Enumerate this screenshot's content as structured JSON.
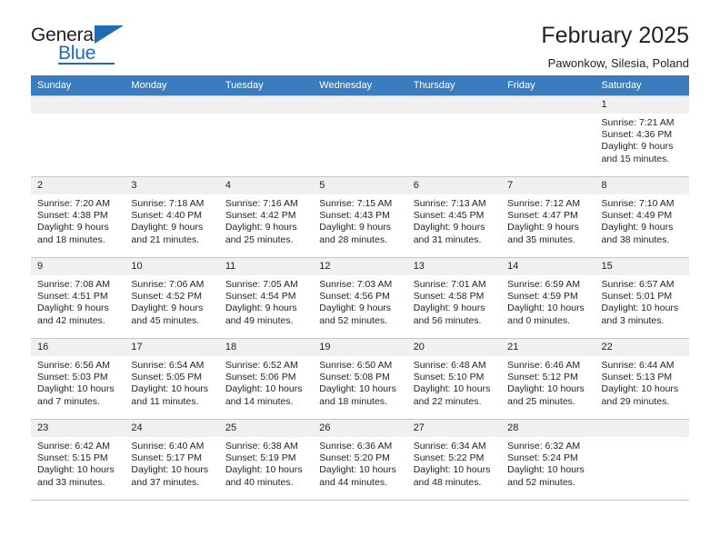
{
  "logo": {
    "word_one": "General",
    "word_two": "Blue",
    "triangle_icon": "triangle-icon"
  },
  "header": {
    "title": "February 2025",
    "location": "Pawonkow, Silesia, Poland"
  },
  "colors": {
    "header_blue": "#3a7cbe",
    "logo_blue": "#1f6cb4",
    "daynum_bg": "#f0f0f0",
    "grid_line": "#c8c8c8",
    "text": "#231f20"
  },
  "weekday_headers": [
    "Sunday",
    "Monday",
    "Tuesday",
    "Wednesday",
    "Thursday",
    "Friday",
    "Saturday"
  ],
  "weeks": [
    [
      {
        "day": "",
        "empty": true
      },
      {
        "day": "",
        "empty": true
      },
      {
        "day": "",
        "empty": true
      },
      {
        "day": "",
        "empty": true
      },
      {
        "day": "",
        "empty": true
      },
      {
        "day": "",
        "empty": true
      },
      {
        "day": "1",
        "sunrise": "Sunrise: 7:21 AM",
        "sunset": "Sunset: 4:36 PM",
        "daylight_line1": "Daylight: 9 hours",
        "daylight_line2": "and 15 minutes."
      }
    ],
    [
      {
        "day": "2",
        "sunrise": "Sunrise: 7:20 AM",
        "sunset": "Sunset: 4:38 PM",
        "daylight_line1": "Daylight: 9 hours",
        "daylight_line2": "and 18 minutes."
      },
      {
        "day": "3",
        "sunrise": "Sunrise: 7:18 AM",
        "sunset": "Sunset: 4:40 PM",
        "daylight_line1": "Daylight: 9 hours",
        "daylight_line2": "and 21 minutes."
      },
      {
        "day": "4",
        "sunrise": "Sunrise: 7:16 AM",
        "sunset": "Sunset: 4:42 PM",
        "daylight_line1": "Daylight: 9 hours",
        "daylight_line2": "and 25 minutes."
      },
      {
        "day": "5",
        "sunrise": "Sunrise: 7:15 AM",
        "sunset": "Sunset: 4:43 PM",
        "daylight_line1": "Daylight: 9 hours",
        "daylight_line2": "and 28 minutes."
      },
      {
        "day": "6",
        "sunrise": "Sunrise: 7:13 AM",
        "sunset": "Sunset: 4:45 PM",
        "daylight_line1": "Daylight: 9 hours",
        "daylight_line2": "and 31 minutes."
      },
      {
        "day": "7",
        "sunrise": "Sunrise: 7:12 AM",
        "sunset": "Sunset: 4:47 PM",
        "daylight_line1": "Daylight: 9 hours",
        "daylight_line2": "and 35 minutes."
      },
      {
        "day": "8",
        "sunrise": "Sunrise: 7:10 AM",
        "sunset": "Sunset: 4:49 PM",
        "daylight_line1": "Daylight: 9 hours",
        "daylight_line2": "and 38 minutes."
      }
    ],
    [
      {
        "day": "9",
        "sunrise": "Sunrise: 7:08 AM",
        "sunset": "Sunset: 4:51 PM",
        "daylight_line1": "Daylight: 9 hours",
        "daylight_line2": "and 42 minutes."
      },
      {
        "day": "10",
        "sunrise": "Sunrise: 7:06 AM",
        "sunset": "Sunset: 4:52 PM",
        "daylight_line1": "Daylight: 9 hours",
        "daylight_line2": "and 45 minutes."
      },
      {
        "day": "11",
        "sunrise": "Sunrise: 7:05 AM",
        "sunset": "Sunset: 4:54 PM",
        "daylight_line1": "Daylight: 9 hours",
        "daylight_line2": "and 49 minutes."
      },
      {
        "day": "12",
        "sunrise": "Sunrise: 7:03 AM",
        "sunset": "Sunset: 4:56 PM",
        "daylight_line1": "Daylight: 9 hours",
        "daylight_line2": "and 52 minutes."
      },
      {
        "day": "13",
        "sunrise": "Sunrise: 7:01 AM",
        "sunset": "Sunset: 4:58 PM",
        "daylight_line1": "Daylight: 9 hours",
        "daylight_line2": "and 56 minutes."
      },
      {
        "day": "14",
        "sunrise": "Sunrise: 6:59 AM",
        "sunset": "Sunset: 4:59 PM",
        "daylight_line1": "Daylight: 10 hours",
        "daylight_line2": "and 0 minutes."
      },
      {
        "day": "15",
        "sunrise": "Sunrise: 6:57 AM",
        "sunset": "Sunset: 5:01 PM",
        "daylight_line1": "Daylight: 10 hours",
        "daylight_line2": "and 3 minutes."
      }
    ],
    [
      {
        "day": "16",
        "sunrise": "Sunrise: 6:56 AM",
        "sunset": "Sunset: 5:03 PM",
        "daylight_line1": "Daylight: 10 hours",
        "daylight_line2": "and 7 minutes."
      },
      {
        "day": "17",
        "sunrise": "Sunrise: 6:54 AM",
        "sunset": "Sunset: 5:05 PM",
        "daylight_line1": "Daylight: 10 hours",
        "daylight_line2": "and 11 minutes."
      },
      {
        "day": "18",
        "sunrise": "Sunrise: 6:52 AM",
        "sunset": "Sunset: 5:06 PM",
        "daylight_line1": "Daylight: 10 hours",
        "daylight_line2": "and 14 minutes."
      },
      {
        "day": "19",
        "sunrise": "Sunrise: 6:50 AM",
        "sunset": "Sunset: 5:08 PM",
        "daylight_line1": "Daylight: 10 hours",
        "daylight_line2": "and 18 minutes."
      },
      {
        "day": "20",
        "sunrise": "Sunrise: 6:48 AM",
        "sunset": "Sunset: 5:10 PM",
        "daylight_line1": "Daylight: 10 hours",
        "daylight_line2": "and 22 minutes."
      },
      {
        "day": "21",
        "sunrise": "Sunrise: 6:46 AM",
        "sunset": "Sunset: 5:12 PM",
        "daylight_line1": "Daylight: 10 hours",
        "daylight_line2": "and 25 minutes."
      },
      {
        "day": "22",
        "sunrise": "Sunrise: 6:44 AM",
        "sunset": "Sunset: 5:13 PM",
        "daylight_line1": "Daylight: 10 hours",
        "daylight_line2": "and 29 minutes."
      }
    ],
    [
      {
        "day": "23",
        "sunrise": "Sunrise: 6:42 AM",
        "sunset": "Sunset: 5:15 PM",
        "daylight_line1": "Daylight: 10 hours",
        "daylight_line2": "and 33 minutes."
      },
      {
        "day": "24",
        "sunrise": "Sunrise: 6:40 AM",
        "sunset": "Sunset: 5:17 PM",
        "daylight_line1": "Daylight: 10 hours",
        "daylight_line2": "and 37 minutes."
      },
      {
        "day": "25",
        "sunrise": "Sunrise: 6:38 AM",
        "sunset": "Sunset: 5:19 PM",
        "daylight_line1": "Daylight: 10 hours",
        "daylight_line2": "and 40 minutes."
      },
      {
        "day": "26",
        "sunrise": "Sunrise: 6:36 AM",
        "sunset": "Sunset: 5:20 PM",
        "daylight_line1": "Daylight: 10 hours",
        "daylight_line2": "and 44 minutes."
      },
      {
        "day": "27",
        "sunrise": "Sunrise: 6:34 AM",
        "sunset": "Sunset: 5:22 PM",
        "daylight_line1": "Daylight: 10 hours",
        "daylight_line2": "and 48 minutes."
      },
      {
        "day": "28",
        "sunrise": "Sunrise: 6:32 AM",
        "sunset": "Sunset: 5:24 PM",
        "daylight_line1": "Daylight: 10 hours",
        "daylight_line2": "and 52 minutes."
      },
      {
        "day": "",
        "empty": true
      }
    ]
  ]
}
